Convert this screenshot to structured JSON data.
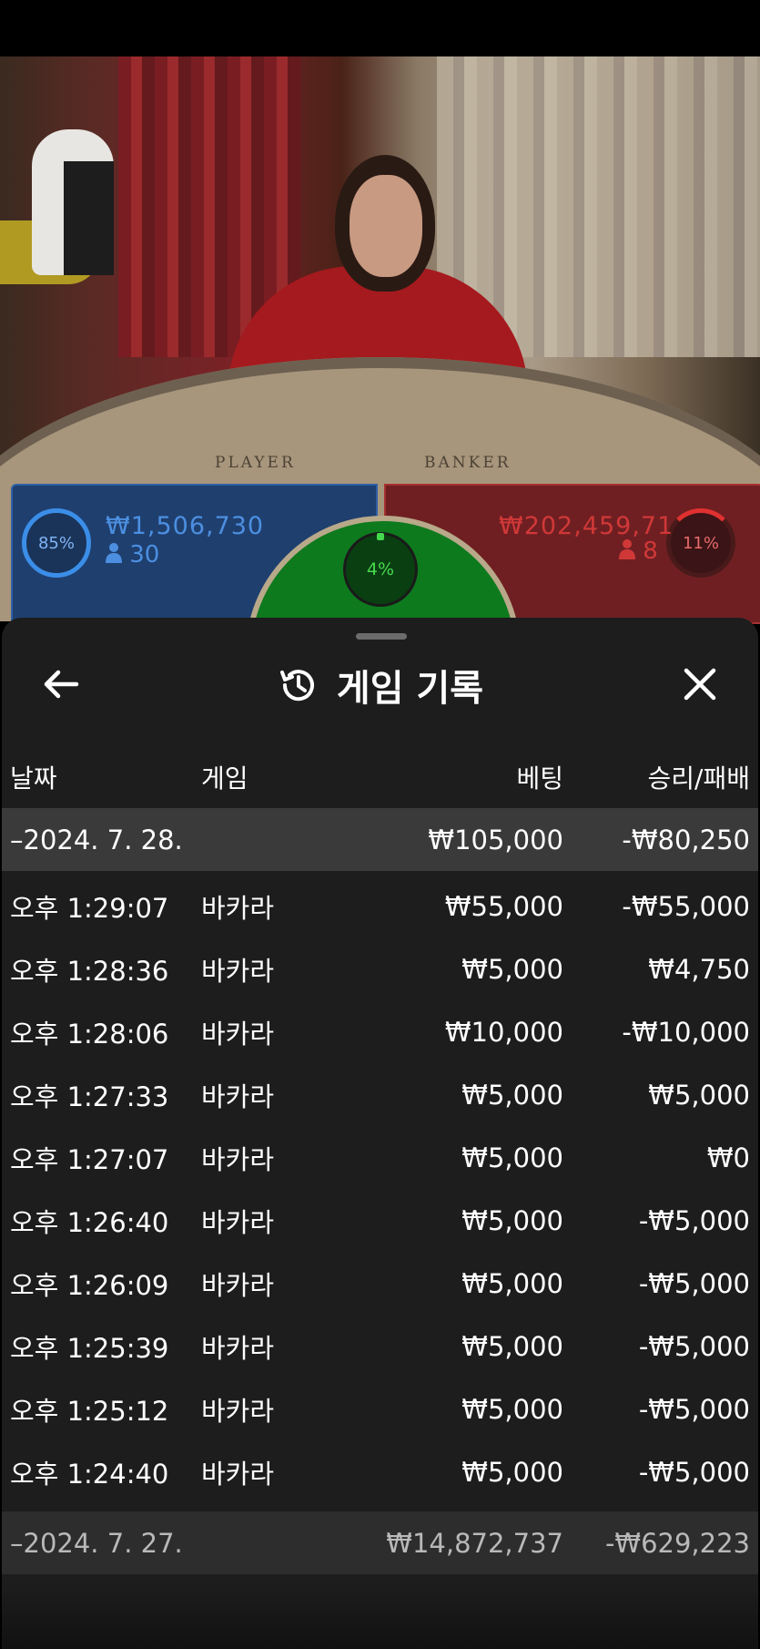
{
  "video": {
    "table_player_text": "PLAYER",
    "table_banker_text": "BANKER"
  },
  "betting": {
    "player": {
      "percent": "85%",
      "amount": "₩1,506,730",
      "count": "30"
    },
    "banker": {
      "percent": "11%",
      "amount": "₩202,459,71",
      "count": "8"
    },
    "tie": {
      "percent": "4%"
    }
  },
  "history": {
    "title": "게임 기록",
    "columns": {
      "date": "날짜",
      "game": "게임",
      "bet": "베팅",
      "winloss": "승리/패배"
    },
    "groups": [
      {
        "date": "–2024. 7. 28.",
        "bet_total": "₩105,000",
        "winloss_total": "-₩80,250",
        "rows": [
          {
            "time": "오후 1:29:07",
            "game": "바카라",
            "bet": "₩55,000",
            "winloss": "-₩55,000"
          },
          {
            "time": "오후 1:28:36",
            "game": "바카라",
            "bet": "₩5,000",
            "winloss": "₩4,750"
          },
          {
            "time": "오후 1:28:06",
            "game": "바카라",
            "bet": "₩10,000",
            "winloss": "-₩10,000"
          },
          {
            "time": "오후 1:27:33",
            "game": "바카라",
            "bet": "₩5,000",
            "winloss": "₩5,000"
          },
          {
            "time": "오후 1:27:07",
            "game": "바카라",
            "bet": "₩5,000",
            "winloss": "₩0"
          },
          {
            "time": "오후 1:26:40",
            "game": "바카라",
            "bet": "₩5,000",
            "winloss": "-₩5,000"
          },
          {
            "time": "오후 1:26:09",
            "game": "바카라",
            "bet": "₩5,000",
            "winloss": "-₩5,000"
          },
          {
            "time": "오후 1:25:39",
            "game": "바카라",
            "bet": "₩5,000",
            "winloss": "-₩5,000"
          },
          {
            "time": "오후 1:25:12",
            "game": "바카라",
            "bet": "₩5,000",
            "winloss": "-₩5,000"
          },
          {
            "time": "오후 1:24:40",
            "game": "바카라",
            "bet": "₩5,000",
            "winloss": "-₩5,000"
          }
        ]
      },
      {
        "date": "–2024. 7. 27.",
        "bet_total": "₩14,872,737",
        "winloss_total": "-₩629,223",
        "rows": []
      }
    ]
  },
  "icons": {
    "back": "arrow-left-icon",
    "history": "history-clock-icon",
    "close": "close-icon",
    "person": "person-icon"
  },
  "colors": {
    "player_blue": "#3b8ee8",
    "banker_red": "#e03030",
    "tie_green": "#46d84c",
    "sheet_bg": "#1d1d1d",
    "date_row_bg": "#3a3a3a"
  }
}
